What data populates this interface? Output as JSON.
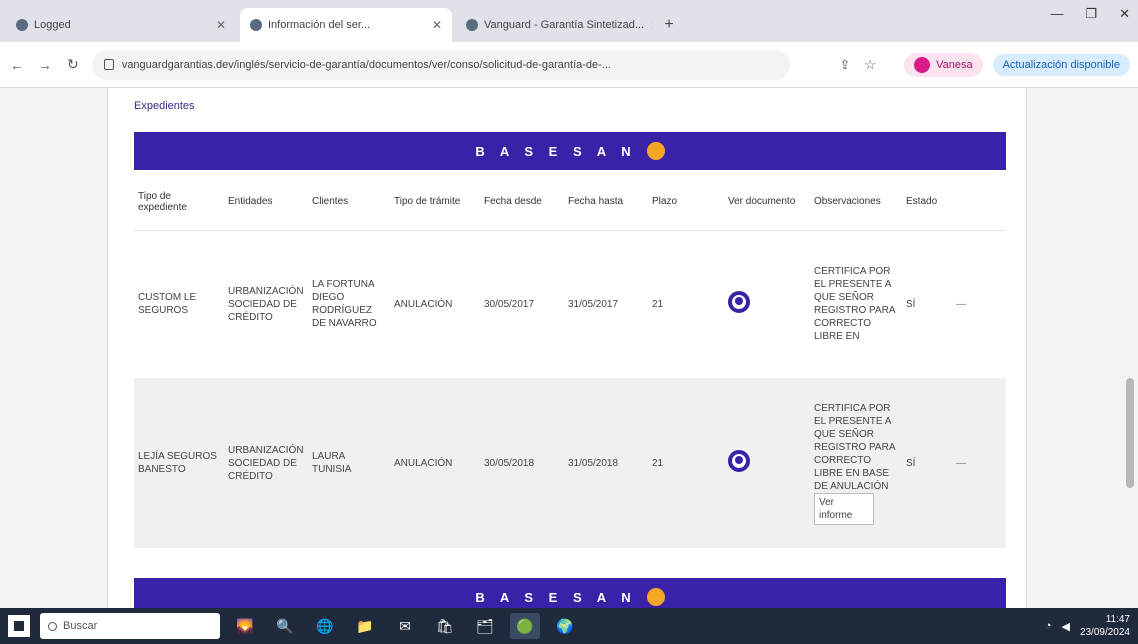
{
  "browser": {
    "tabs": [
      {
        "title": "Logged",
        "active": false
      },
      {
        "title": "Información del ser...",
        "active": true
      },
      {
        "title": "Vanguard - Garantía Sintetizad...",
        "active": false
      }
    ],
    "new_tab": "+",
    "window_controls": {
      "minimize": "—",
      "maximize": "❐",
      "close": "✕"
    },
    "nav": {
      "back": "←",
      "forward": "→",
      "reload": "↻"
    },
    "url": "vanguardgarantias.dev/inglés/servicio-de-garantía/documentos/ver/conso/solicitud-de-garantía-de-...",
    "toolbar_icons": {
      "share": "⇪",
      "star": "☆"
    },
    "profile_label": "Vanesa",
    "update_label": "Actualización disponible"
  },
  "page": {
    "section_title": "Expedientes",
    "banner_label": "B A S E S A N",
    "table": {
      "headers": [
        "Tipo de expediente",
        "Entidades",
        "Clientes",
        "Tipo de trámite",
        "Fecha desde",
        "Fecha hasta",
        "Plazo",
        "Ver documento",
        "Observaciones",
        "Estado",
        ""
      ],
      "rows": [
        {
          "tipo": "CUSTOM LE SEGUROS",
          "entidad": "URBANIZACIÓN SOCIEDAD DE CRÉDITO",
          "cliente": "LA FORTUNA DIEGO RODRÍGUEZ DE NAVARRO",
          "tramite": "ANULACIÓN",
          "desde": "30/05/2017",
          "hasta": "31/05/2017",
          "plazo": "21",
          "observacion": "CERTIFICA POR EL PRESENTE A QUE SEÑOR REGISTRO PARA CORRECTO LIBRE EN",
          "estado": "SÍ",
          "accion": "—"
        },
        {
          "tipo": "LEJÍA SEGUROS BANESTO",
          "entidad": "URBANIZACIÓN SOCIEDAD DE CRÉDITO",
          "cliente": "LAURA TUNISIA",
          "tramite": "ANULACIÓN",
          "desde": "30/05/2018",
          "hasta": "31/05/2018",
          "plazo": "21",
          "observacion": "CERTIFICA POR EL PRESENTE A QUE SEÑOR REGISTRO PARA CORRECTO LIBRE EN BASE DE ANULACIÓN",
          "edit_value": "Ver informe",
          "estado": "SÍ",
          "accion": "—"
        }
      ]
    }
  },
  "taskbar": {
    "search_placeholder": "Buscar",
    "apps": [
      "🌄",
      "🔍",
      "🌐",
      "📁",
      "✉",
      "🛍",
      "🗂",
      "🟢",
      "🌍"
    ],
    "time": "11:47",
    "date": "23/09/2024"
  }
}
